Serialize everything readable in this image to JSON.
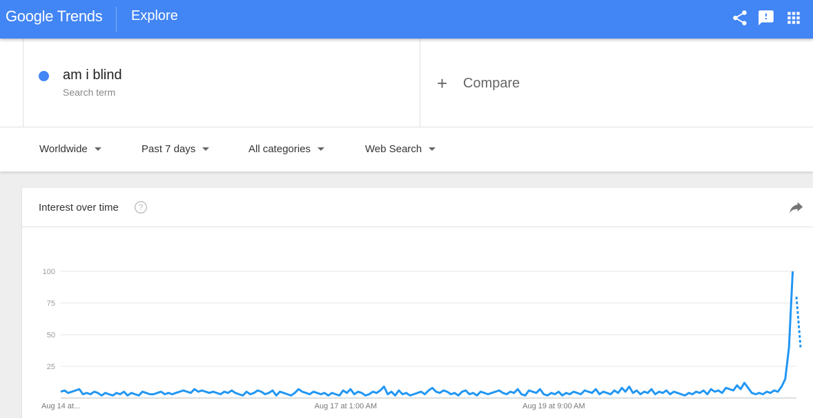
{
  "header": {
    "logo_google": "Google",
    "logo_trends": "Trends",
    "section": "Explore",
    "icons": [
      "share-icon",
      "feedback-icon",
      "apps-grid-icon"
    ]
  },
  "search": {
    "term": "am i blind",
    "term_type": "Search term",
    "term_color": "#4285f4",
    "compare_label": "Compare"
  },
  "filters": {
    "region": "Worldwide",
    "time_range": "Past 7 days",
    "category": "All categories",
    "property": "Web Search"
  },
  "card": {
    "title": "Interest over time"
  },
  "colors": {
    "brand": "#4285f4",
    "series": "#2196f3"
  },
  "chart_data": {
    "type": "line",
    "title": "Interest over time",
    "y_ticks": [
      25,
      50,
      75,
      100
    ],
    "ylim": [
      0,
      100
    ],
    "x_tick_labels": [
      "Aug 14 at...",
      "Aug 17 at 1:00 AM",
      "Aug 19 at 9:00 AM"
    ],
    "x_tick_indices": [
      0,
      72,
      128
    ],
    "grid": true,
    "legend": "none",
    "series": [
      {
        "values": [
          5,
          6,
          4,
          5,
          6,
          7,
          3,
          4,
          3,
          5,
          4,
          2,
          4,
          3,
          2,
          4,
          3,
          5,
          2,
          4,
          3,
          2,
          5,
          4,
          3,
          3,
          4,
          5,
          3,
          4,
          3,
          4,
          5,
          6,
          5,
          4,
          7,
          5,
          6,
          5,
          4,
          5,
          4,
          3,
          5,
          4,
          6,
          4,
          3,
          2,
          5,
          3,
          4,
          6,
          5,
          3,
          4,
          6,
          2,
          5,
          4,
          3,
          2,
          4,
          7,
          5,
          4,
          3,
          5,
          4,
          3,
          4,
          2,
          4,
          3,
          2,
          6,
          4,
          7,
          3,
          5,
          4,
          2,
          3,
          5,
          4,
          6,
          9,
          3,
          5,
          2,
          6,
          3,
          4,
          2,
          3,
          4,
          5,
          3,
          6,
          8,
          5,
          4,
          6,
          5,
          3,
          4,
          2,
          5,
          6,
          3,
          4,
          2,
          5,
          4,
          3,
          4,
          5,
          6,
          4,
          3,
          5,
          4,
          7,
          3,
          2,
          6,
          5,
          4,
          7,
          3,
          2,
          4,
          3,
          5,
          2,
          4,
          3,
          5,
          4,
          3,
          6,
          5,
          4,
          7,
          3,
          5,
          4,
          3,
          6,
          4,
          8,
          5,
          9,
          4,
          6,
          3,
          5,
          4,
          7,
          3,
          5,
          4,
          6,
          3,
          5,
          4,
          3,
          2,
          4,
          3,
          5,
          4,
          6,
          3,
          7,
          5,
          6,
          4,
          8,
          7,
          6,
          10,
          7,
          12,
          8,
          4,
          3,
          4,
          3,
          5,
          4,
          6,
          5,
          9,
          15,
          40,
          100,
          80
        ],
        "partial_values": [
          80,
          40
        ]
      }
    ]
  }
}
